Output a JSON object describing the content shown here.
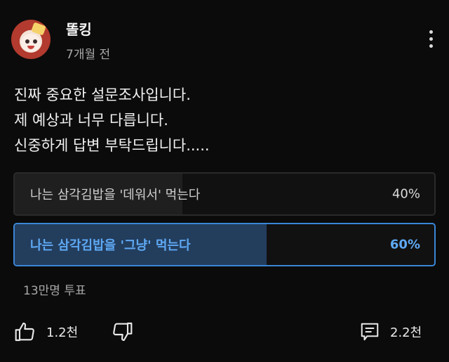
{
  "author": {
    "name": "똘킹",
    "time": "7개월 전"
  },
  "post": {
    "lines": [
      "진짜 중요한 설문조사입니다.",
      "제 예상과 너무 다릅니다.",
      "신중하게 답변 부탁드립니다....."
    ]
  },
  "poll": {
    "options": [
      {
        "label": "나는 삼각김밥을 '데워서' 먹는다",
        "percent": "40%",
        "fraction": 0.4,
        "selected": false
      },
      {
        "label": "나는 삼각김밥을 '그냥' 먹는다",
        "percent": "60%",
        "fraction": 0.6,
        "selected": true
      }
    ],
    "votes": "13만명 투표"
  },
  "actions": {
    "likes": "1.2천",
    "comments": "2.2천"
  },
  "colors": {
    "accent": "#3a86d6",
    "selected_text": "#5ea9f4",
    "background": "#0b0b0b"
  },
  "icons": [
    "more-vert-icon",
    "thumb-up-icon",
    "thumb-down-icon",
    "comment-icon"
  ]
}
